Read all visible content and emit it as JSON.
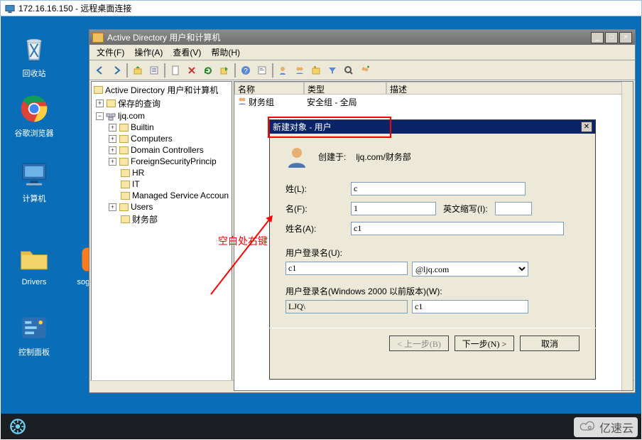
{
  "rdc": {
    "title": "172.16.16.150 - 远程桌面连接"
  },
  "desktop": {
    "icons": {
      "recycle": "回收站",
      "chrome": "谷歌浏览器",
      "computer": "计算机",
      "drivers": "Drivers",
      "sogou": "sogou_…",
      "control_panel": "控制面板"
    }
  },
  "aduc": {
    "title": "Active Directory 用户和计算机",
    "menu": {
      "file": "文件(F)",
      "action": "操作(A)",
      "view": "查看(V)",
      "help": "帮助(H)"
    },
    "tree": {
      "root": "Active Directory 用户和计算机",
      "saved": "保存的查询",
      "domain": "ljq.com",
      "builtin": "Builtin",
      "computers": "Computers",
      "dcs": "Domain Controllers",
      "fsp": "ForeignSecurityPrincip",
      "hr": "HR",
      "it": "IT",
      "msa": "Managed Service Accoun",
      "users": "Users",
      "finance": "财务部"
    },
    "list": {
      "columns": {
        "name": "名称",
        "type": "类型",
        "desc": "描述"
      },
      "rows": [
        {
          "name": "财务组",
          "type": "安全组 - 全局",
          "desc": ""
        }
      ]
    }
  },
  "dialog": {
    "title": "新建对象 - 用户",
    "created_in_label": "创建于:",
    "created_in_value": "ljq.com/财务部",
    "labels": {
      "surname": "姓(L):",
      "givenname": "名(F):",
      "initials": "英文缩写(I):",
      "fullname": "姓名(A):",
      "logon": "用户登录名(U):",
      "logon_pre": "用户登录名(Windows 2000 以前版本)(W):"
    },
    "values": {
      "surname": "c",
      "givenname": "1",
      "initials": "",
      "fullname": "c1",
      "logon": "c1",
      "domain_suffix": "@ljq.com",
      "netbios": "LJQ\\",
      "sam": "c1"
    },
    "buttons": {
      "back": "< 上一步(B)",
      "next": "下一步(N) >",
      "cancel": "取消"
    }
  },
  "annotation": {
    "text": "空白处右键"
  },
  "watermark": {
    "text": "亿速云"
  }
}
